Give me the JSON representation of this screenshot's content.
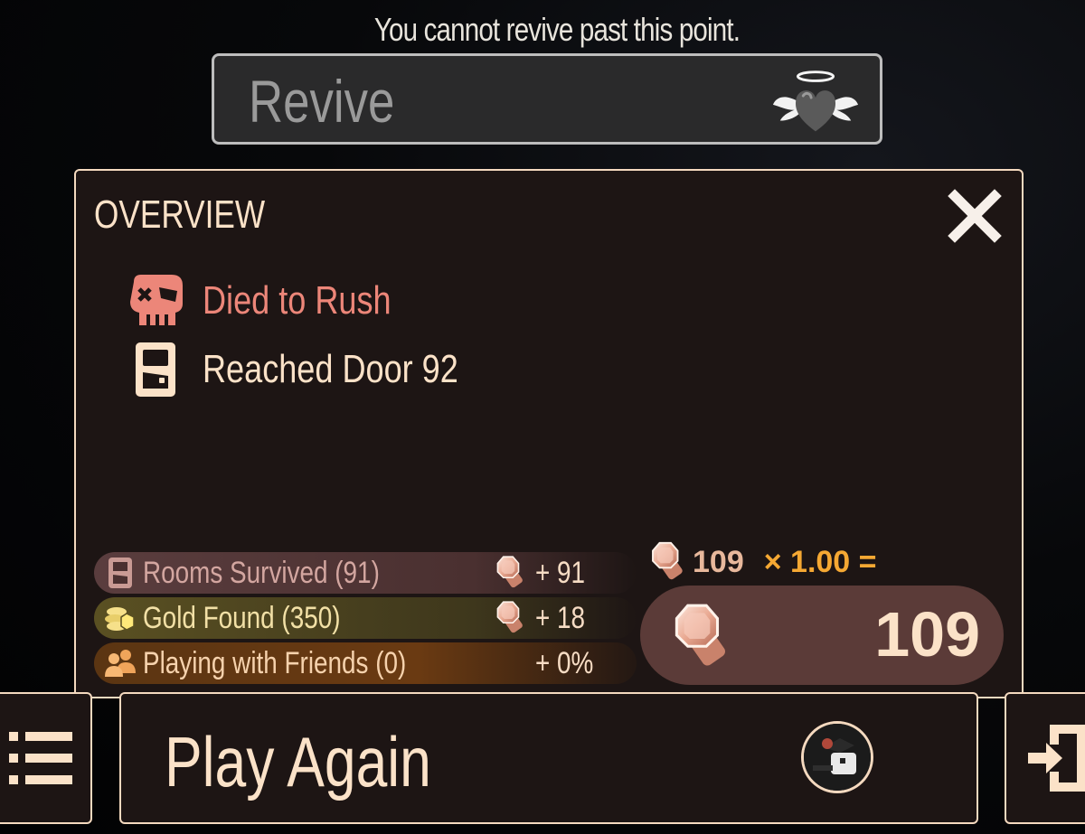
{
  "notice": "You cannot revive past this point.",
  "revive": {
    "label": "Revive",
    "icon": "angel-heart-icon"
  },
  "overview": {
    "title": "OVERVIEW",
    "death": {
      "text": "Died to Rush",
      "icon": "skull-icon",
      "color": "#ec8679"
    },
    "door": {
      "text": "Reached Door 92",
      "icon": "door-icon",
      "color": "#fbe2c8"
    },
    "stats": [
      {
        "label": "Rooms Survived (91)",
        "value": "+ 91",
        "icon": "door-icon",
        "reward_icon": "knob-icon"
      },
      {
        "label": "Gold Found (350)",
        "value": "+ 18",
        "icon": "gold-coins-icon",
        "reward_icon": "knob-icon"
      },
      {
        "label": "Playing with Friends (0)",
        "value": "+ 0%",
        "icon": "friends-icon"
      }
    ],
    "calc": {
      "base": "109",
      "multiplier": "× 1.00 ="
    },
    "total": "109"
  },
  "buttons": {
    "play_again": "Play Again",
    "menu_icon": "menu-list-icon",
    "exit_icon": "exit-door-icon"
  },
  "colors": {
    "panel_bg": "#1d1514",
    "panel_border": "#f4d9bf",
    "text_cream": "#fbe2c8",
    "accent_orange": "#f5a833",
    "death_red": "#ec8679"
  }
}
